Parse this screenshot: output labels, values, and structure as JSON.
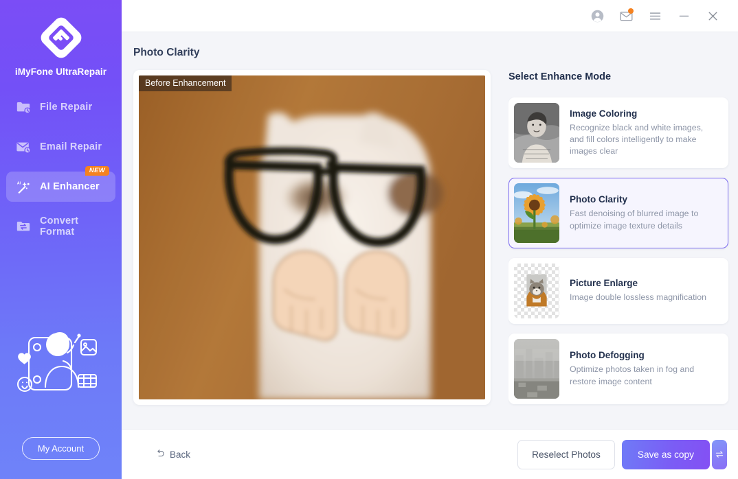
{
  "sidebar": {
    "brand": "iMyFone UltraRepair",
    "logo_icon": "diamond-f-logo",
    "items": [
      {
        "label": "File Repair",
        "icon": "folder-clock-icon",
        "active": false,
        "badge": ""
      },
      {
        "label": "Email Repair",
        "icon": "envelope-clock-icon",
        "active": false,
        "badge": ""
      },
      {
        "label": "AI Enhancer",
        "icon": "magic-wand-ai-icon",
        "active": true,
        "badge": "NEW"
      },
      {
        "label": "Convert Format",
        "icon": "folder-swap-icon",
        "active": false,
        "badge": ""
      }
    ],
    "account_button": "My Account",
    "illustration_icon": "person-in-frame-illustration"
  },
  "titlebar": {
    "account_icon": "account-circle-icon",
    "mail_icon": "mail-envelope-icon",
    "menu_icon": "hamburger-menu-icon",
    "minimize_icon": "minimize-icon",
    "close_icon": "close-icon",
    "mail_has_badge": true
  },
  "main": {
    "page_title": "Photo Clarity",
    "preview": {
      "badge": "Before Enhancement",
      "image_alt": "blurred-photo-preview"
    }
  },
  "modes": {
    "title": "Select Enhance Mode",
    "items": [
      {
        "name": "Image Coloring",
        "desc": "Recognize black and white images, and fill colors intelligently to make images clear",
        "thumb": "vintage-bw-portrait-thumbnail",
        "selected": false
      },
      {
        "name": "Photo Clarity",
        "desc": "Fast denoising of blurred image to optimize image texture details",
        "thumb": "sunflower-field-thumbnail",
        "selected": true
      },
      {
        "name": "Picture Enlarge",
        "desc": "Image double lossless magnification",
        "thumb": "cat-transparent-thumbnail",
        "selected": false
      },
      {
        "name": "Photo Defogging",
        "desc": "Optimize photos taken in fog and restore image content",
        "thumb": "foggy-city-thumbnail",
        "selected": false
      }
    ]
  },
  "bottombar": {
    "back_label": "Back",
    "back_icon": "undo-arrow-icon",
    "reselect_label": "Reselect Photos",
    "save_label": "Save as copy",
    "save_more_icon": "swap-arrows-icon"
  },
  "colors": {
    "brand_purple": "#7b4df6",
    "brand_periwinkle": "#6f83f9",
    "accent_orange": "#f58220",
    "selected_border": "#7b6af0",
    "page_bg": "#f4f5f9"
  }
}
